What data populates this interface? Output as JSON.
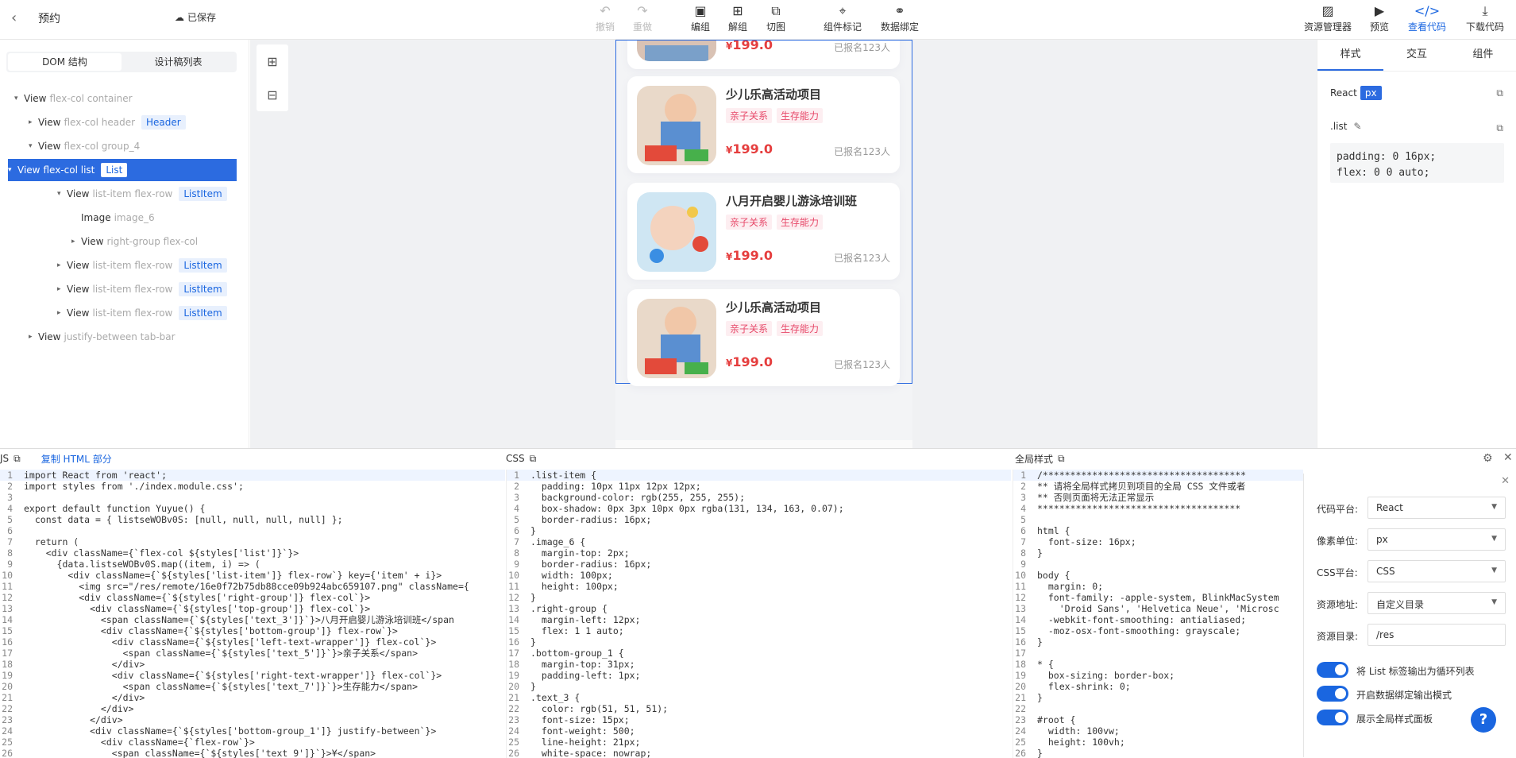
{
  "header": {
    "back_icon": "chevron-left-icon",
    "title": "预约",
    "saved": "已保存"
  },
  "toolbar": {
    "undo": "撤销",
    "redo": "重做",
    "group": "编组",
    "ungroup": "解组",
    "slice": "切图",
    "mark": "组件标记",
    "bind": "数据绑定",
    "assets": "资源管理器",
    "preview": "预览",
    "code": "查看代码",
    "download": "下载代码"
  },
  "left": {
    "tabs": [
      "DOM 结构",
      "设计稿列表"
    ],
    "tree": [
      {
        "label": "View",
        "cls": "flex-col container",
        "tag": "",
        "arrow": "▾",
        "indent": 0
      },
      {
        "label": "View",
        "cls": "flex-col header",
        "tag": "Header",
        "arrow": "▸",
        "indent": 1
      },
      {
        "label": "View",
        "cls": "flex-col group_4",
        "tag": "",
        "arrow": "▾",
        "indent": 1
      },
      {
        "label": "View",
        "cls": "flex-col list",
        "tag": "List",
        "arrow": "▾",
        "indent": 2
      },
      {
        "label": "View",
        "cls": "list-item flex-row",
        "tag": "ListItem",
        "arrow": "▾",
        "indent": 3
      },
      {
        "label": "Image",
        "cls": "image_6",
        "tag": "",
        "arrow": "",
        "indent": 4
      },
      {
        "label": "View",
        "cls": "right-group flex-col",
        "tag": "",
        "arrow": "▸",
        "indent": 4
      },
      {
        "label": "View",
        "cls": "list-item flex-row",
        "tag": "ListItem",
        "arrow": "▸",
        "indent": 3
      },
      {
        "label": "View",
        "cls": "list-item flex-row",
        "tag": "ListItem",
        "arrow": "▸",
        "indent": 3
      },
      {
        "label": "View",
        "cls": "list-item flex-row",
        "tag": "ListItem",
        "arrow": "▸",
        "indent": 3
      },
      {
        "label": "View",
        "cls": "justify-between tab-bar",
        "tag": "",
        "arrow": "▸",
        "indent": 1
      }
    ]
  },
  "cards": [
    {
      "name": "少儿乐高活动项目",
      "tag1": "亲子关系",
      "tag2": "生存能力",
      "currency": "¥",
      "price": "199.0",
      "count": "已报名123人"
    },
    {
      "name": "八月开启婴儿游泳培训班",
      "tag1": "亲子关系",
      "tag2": "生存能力",
      "currency": "¥",
      "price": "199.0",
      "count": "已报名123人"
    },
    {
      "name": "少儿乐高活动项目",
      "tag1": "亲子关系",
      "tag2": "生存能力",
      "currency": "¥",
      "price": "199.0",
      "count": "已报名123人"
    }
  ],
  "partial_card": {
    "currency": "¥",
    "price": "199.0",
    "count": "已报名123人"
  },
  "right": {
    "tabs": [
      "样式",
      "交互",
      "组件"
    ],
    "platform": "React",
    "unit": "px",
    "selector": ".list",
    "css": [
      "padding: 0 16px;",
      "flex: 0 0 auto;"
    ]
  },
  "bottom": {
    "js_title": "JS",
    "copy_html": "复制 HTML 部分",
    "css_title": "CSS",
    "global_title": "全局样式",
    "js_lines": [
      "import React from 'react';",
      "import styles from './index.module.css';",
      "",
      "export default function Yuyue() {",
      "  const data = { listseWOBv0S: [null, null, null, null] };",
      "",
      "  return (",
      "    <div className={`flex-col ${styles['list']}`}>",
      "      {data.listseWOBv0S.map((item, i) => (",
      "        <div className={`${styles['list-item']} flex-row`} key={'item' + i}>",
      "          <img src=\"/res/remote/16e0f72b75db88cce09b924abc659107.png\" className={",
      "          <div className={`${styles['right-group']} flex-col`}>",
      "            <div className={`${styles['top-group']} flex-col`}>",
      "              <span className={`${styles['text_3']}`}>八月开启婴儿游泳培训班</span",
      "              <div className={`${styles['bottom-group']} flex-row`}>",
      "                <div className={`${styles['left-text-wrapper']} flex-col`}>",
      "                  <span className={`${styles['text_5']}`}>亲子关系</span>",
      "                </div>",
      "                <div className={`${styles['right-text-wrapper']} flex-col`}>",
      "                  <span className={`${styles['text_7']}`}>生存能力</span>",
      "                </div>",
      "              </div>",
      "            </div>",
      "            <div className={`${styles['bottom-group_1']} justify-between`}>",
      "              <div className={`flex-row`}>",
      "                <span className={`${styles['text_9']}`}>¥</span>"
    ],
    "css_lines": [
      ".list-item {",
      "  padding: 10px 11px 12px 12px;",
      "  background-color: rgb(255, 255, 255);",
      "  box-shadow: 0px 3px 10px 0px rgba(131, 134, 163, 0.07);",
      "  border-radius: 16px;",
      "}",
      ".image_6 {",
      "  margin-top: 2px;",
      "  border-radius: 16px;",
      "  width: 100px;",
      "  height: 100px;",
      "}",
      ".right-group {",
      "  margin-left: 12px;",
      "  flex: 1 1 auto;",
      "}",
      ".bottom-group_1 {",
      "  margin-top: 31px;",
      "  padding-left: 1px;",
      "}",
      ".text_3 {",
      "  color: rgb(51, 51, 51);",
      "  font-size: 15px;",
      "  font-weight: 500;",
      "  line-height: 21px;",
      "  white-space: nowrap;"
    ],
    "global_lines": [
      "/*************************************",
      "** 请将全局样式拷贝到项目的全局 CSS 文件或者",
      "** 否则页面将无法正常显示",
      "*************************************",
      "",
      "html {",
      "  font-size: 16px;",
      "}",
      "",
      "body {",
      "  margin: 0;",
      "  font-family: -apple-system, BlinkMacSystem",
      "    'Droid Sans', 'Helvetica Neue', 'Microsc",
      "  -webkit-font-smoothing: antialiased;",
      "  -moz-osx-font-smoothing: grayscale;",
      "}",
      "",
      "* {",
      "  box-sizing: border-box;",
      "  flex-shrink: 0;",
      "}",
      "",
      "#root {",
      "  width: 100vw;",
      "  height: 100vh;",
      "}"
    ]
  },
  "settings": {
    "platform_label": "代码平台:",
    "platform": "React",
    "unit_label": "像素单位:",
    "unit": "px",
    "css_label": "CSS平台:",
    "css": "CSS",
    "res_label": "资源地址:",
    "res": "自定义目录",
    "dir_label": "资源目录:",
    "dir": "/res",
    "toggle1": "将 List 标签输出为循环列表",
    "toggle2": "开启数据绑定输出模式",
    "toggle3": "展示全局样式面板",
    "help": "?"
  }
}
